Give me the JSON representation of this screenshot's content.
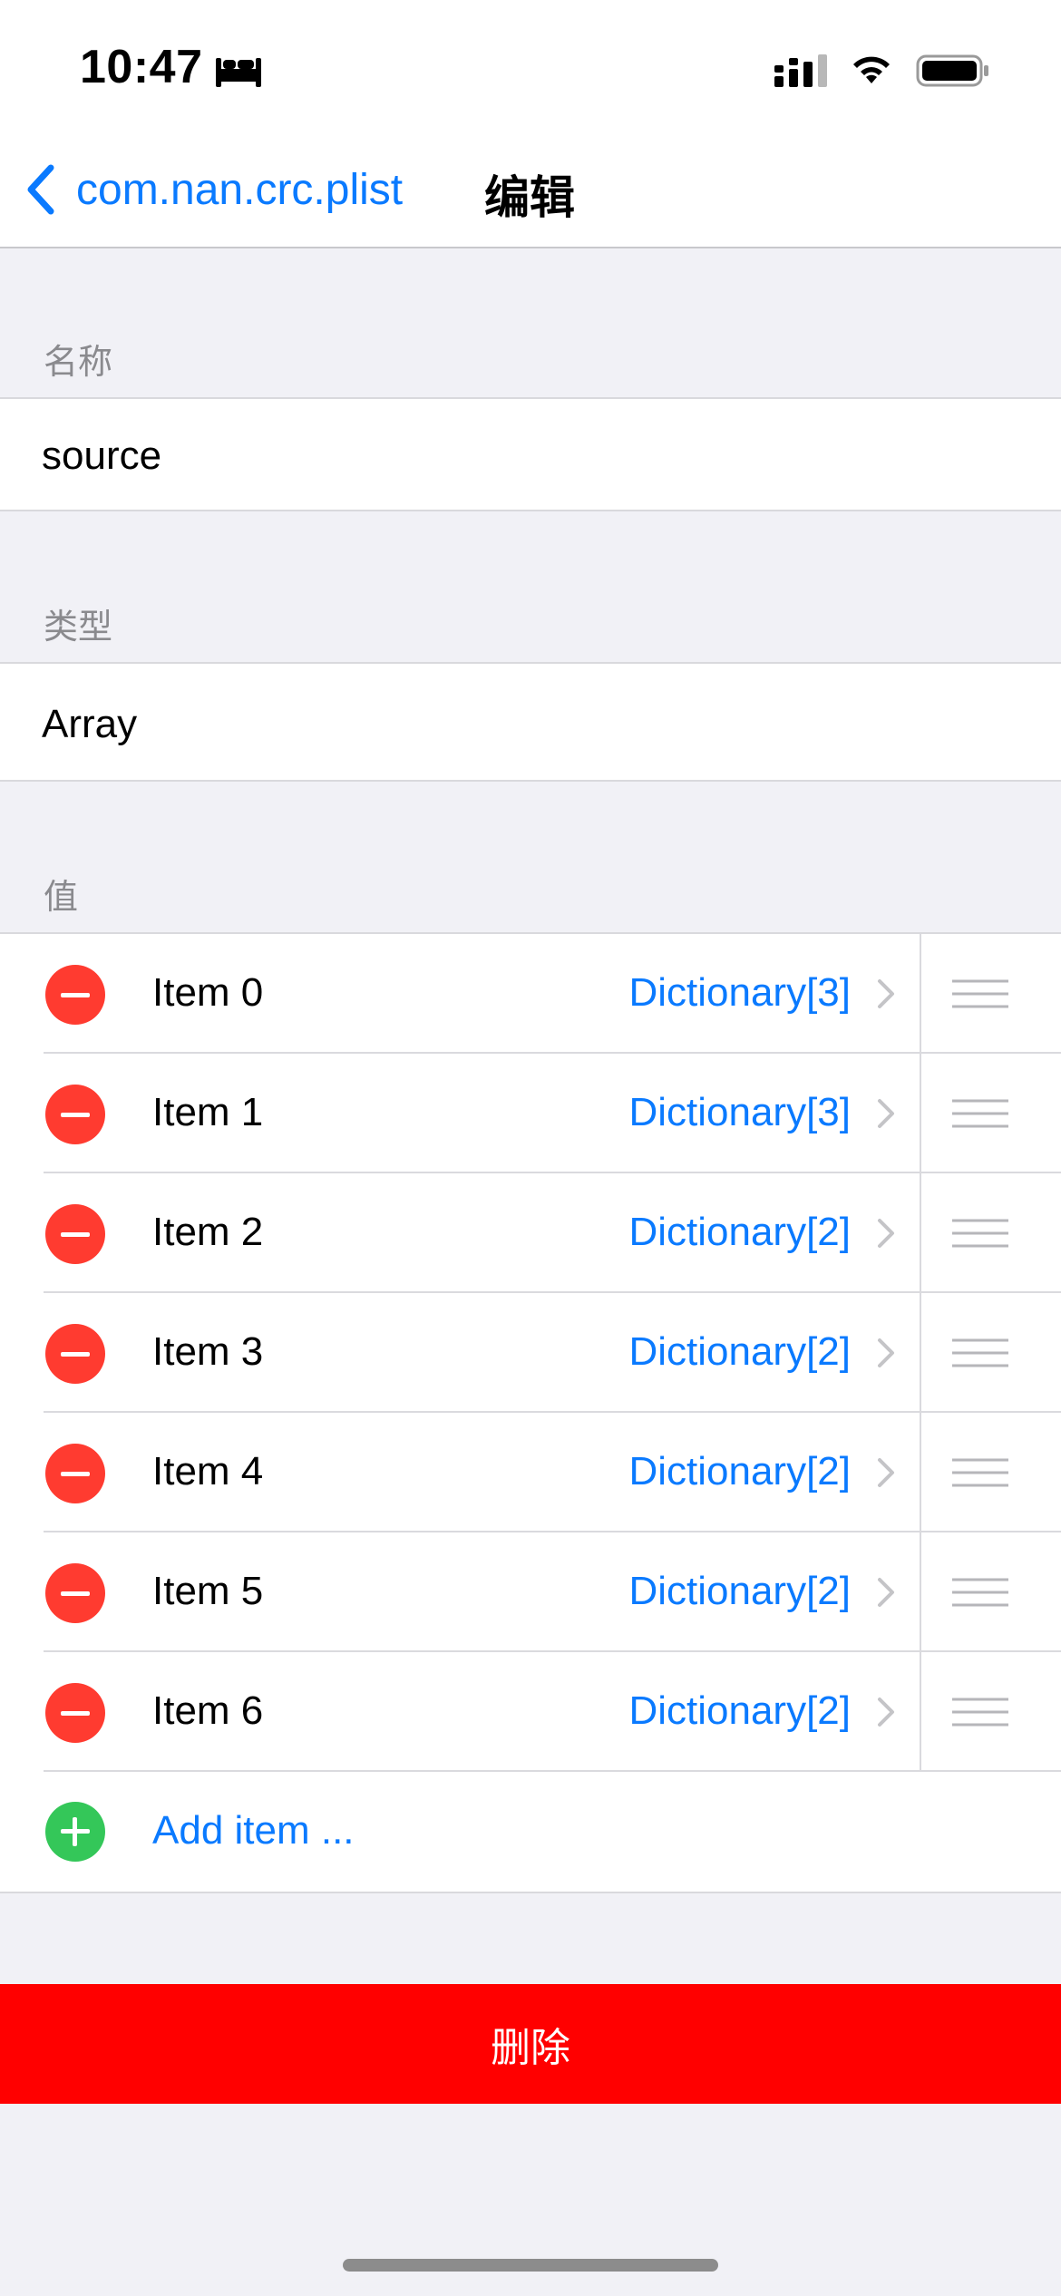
{
  "status_bar": {
    "time": "10:47",
    "icons": [
      "bed-icon",
      "signal-icon",
      "wifi-icon",
      "battery-icon"
    ]
  },
  "nav": {
    "back_label": "com.nan.crc.plist",
    "title": "编辑"
  },
  "name_section": {
    "header": "名称",
    "value": "source"
  },
  "type_section": {
    "header": "类型",
    "value": "Array"
  },
  "value_section": {
    "header": "值",
    "items": [
      {
        "label": "Item 0",
        "value": "Dictionary[3]"
      },
      {
        "label": "Item 1",
        "value": "Dictionary[3]"
      },
      {
        "label": "Item 2",
        "value": "Dictionary[2]"
      },
      {
        "label": "Item 3",
        "value": "Dictionary[2]"
      },
      {
        "label": "Item 4",
        "value": "Dictionary[2]"
      },
      {
        "label": "Item 5",
        "value": "Dictionary[2]"
      },
      {
        "label": "Item 6",
        "value": "Dictionary[2]"
      }
    ],
    "add_label": "Add item ..."
  },
  "delete_label": "删除",
  "colors": {
    "accent": "#0a7aff",
    "destructive": "#ff3b30",
    "add": "#34c759",
    "delete_button": "#ff0000",
    "background": "#f1f1f6"
  }
}
